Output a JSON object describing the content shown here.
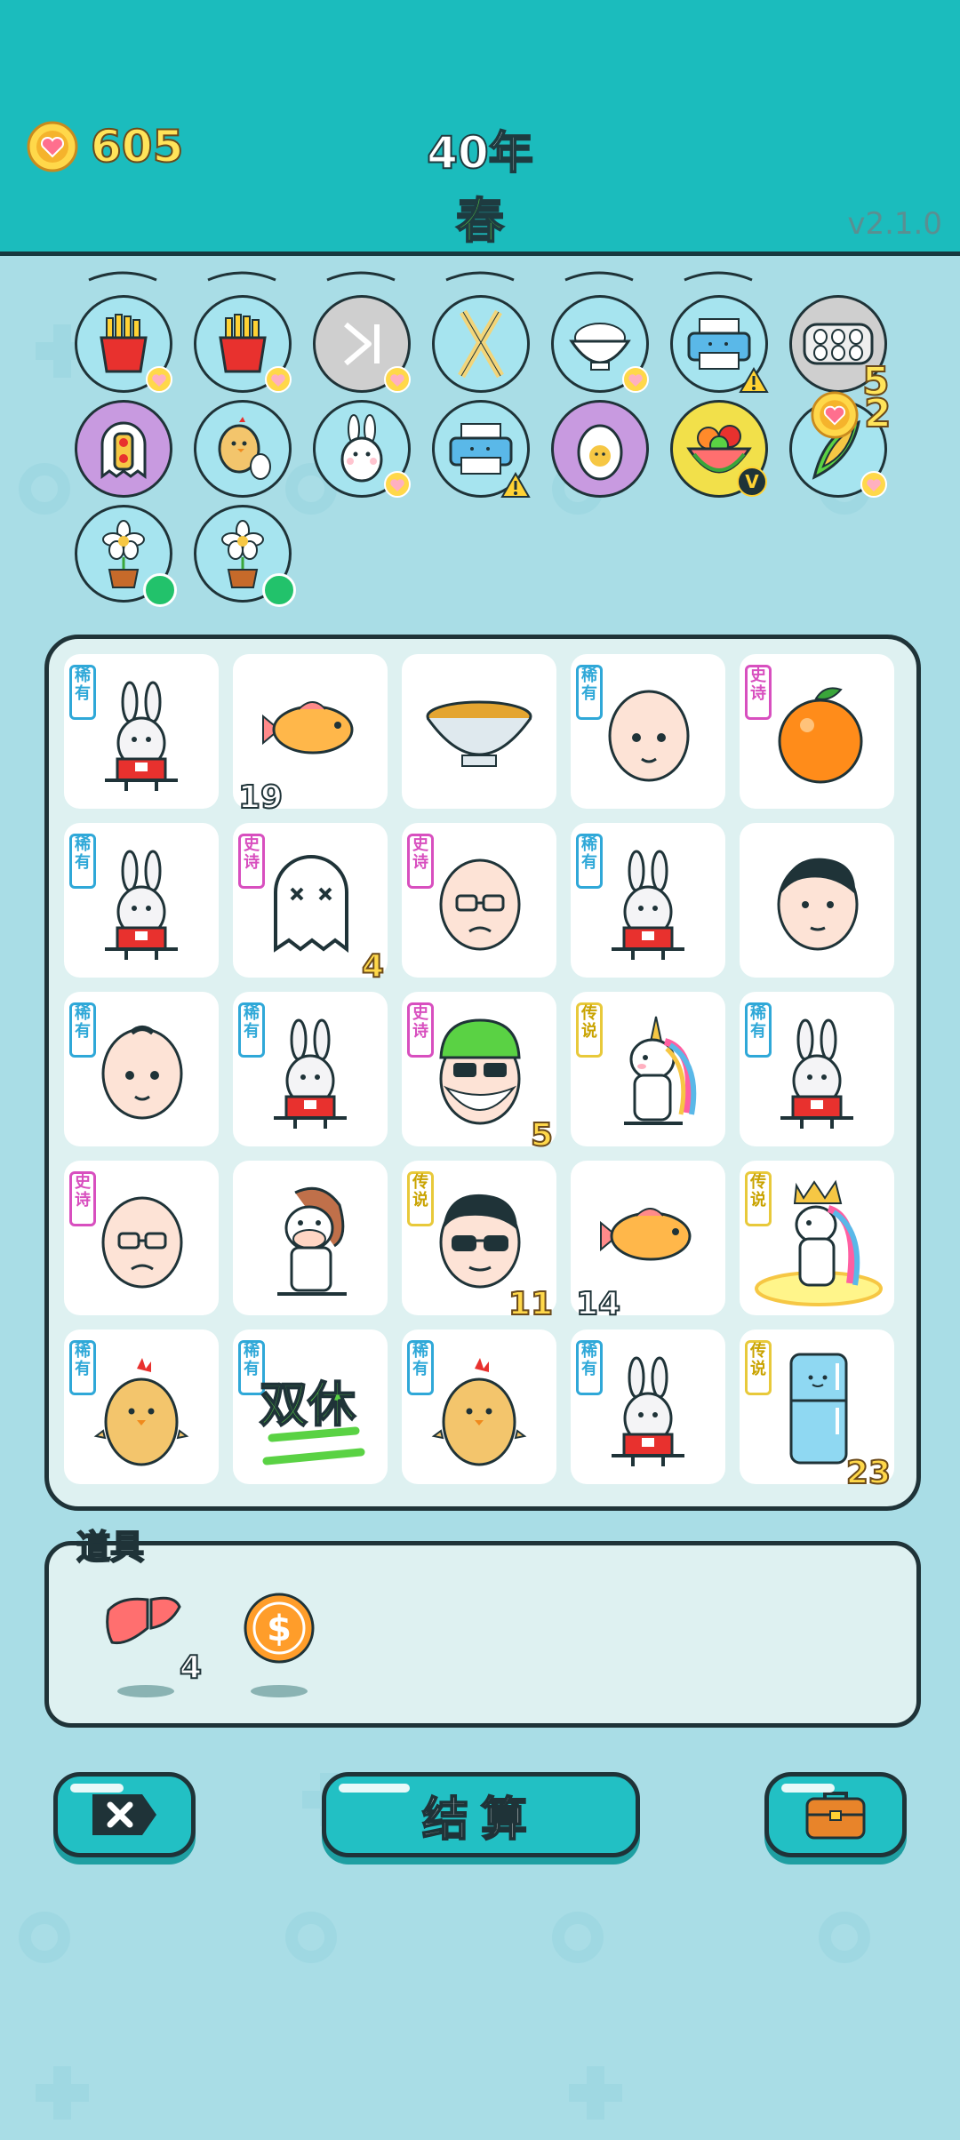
{
  "header": {
    "coins": "605",
    "year": "40年",
    "season": "春",
    "version": "v2.1.0"
  },
  "inventory": {
    "row1": [
      "fries",
      "fries",
      "skip",
      "chopsticks",
      "rice-bowl",
      "printer",
      "egg-carton"
    ],
    "row2": [
      "ghost-lantern",
      "chick-egg",
      "rabbit",
      "printer",
      "egg",
      "fruit-bowl",
      "corn"
    ],
    "row3": [
      "flower-pot",
      "flower-pot"
    ],
    "egg_count": "5",
    "corn_count": "2"
  },
  "board": {
    "tags": {
      "rare": "稀有",
      "epic": "史诗",
      "legend": "传说"
    },
    "cells": [
      {
        "item": "rabbit",
        "tag": "rare",
        "num": ""
      },
      {
        "item": "fish",
        "tag": "",
        "num": "19",
        "numStyle": "white"
      },
      {
        "item": "soup-bowl",
        "tag": "",
        "num": ""
      },
      {
        "item": "bald-man",
        "tag": "rare",
        "num": ""
      },
      {
        "item": "orange",
        "tag": "epic",
        "num": ""
      },
      {
        "item": "rabbit",
        "tag": "rare",
        "num": ""
      },
      {
        "item": "ghost",
        "tag": "epic",
        "num": "4",
        "numStyle": "yellow"
      },
      {
        "item": "old-man-glasses",
        "tag": "epic",
        "num": ""
      },
      {
        "item": "rabbit",
        "tag": "rare",
        "num": ""
      },
      {
        "item": "man-face",
        "tag": "",
        "num": ""
      },
      {
        "item": "bald-man",
        "tag": "rare",
        "num": ""
      },
      {
        "item": "rabbit",
        "tag": "rare",
        "num": ""
      },
      {
        "item": "green-hat-man",
        "tag": "epic",
        "num": "5",
        "numStyle": "yellow"
      },
      {
        "item": "unicorn",
        "tag": "legend",
        "num": ""
      },
      {
        "item": "rabbit",
        "tag": "rare",
        "num": ""
      },
      {
        "item": "old-man-glasses",
        "tag": "epic",
        "num": ""
      },
      {
        "item": "horse",
        "tag": "",
        "num": ""
      },
      {
        "item": "sunglasses-man",
        "tag": "legend",
        "num": "11",
        "numStyle": "yellow"
      },
      {
        "item": "fish",
        "tag": "",
        "num": "14",
        "numStyle": "white"
      },
      {
        "item": "unicorn-king",
        "tag": "legend",
        "num": ""
      },
      {
        "item": "chick",
        "tag": "rare",
        "num": ""
      },
      {
        "item": "weekend-sign",
        "tag": "rare",
        "num": "",
        "text": "双休"
      },
      {
        "item": "chick",
        "tag": "rare",
        "num": ""
      },
      {
        "item": "rabbit",
        "tag": "rare",
        "num": ""
      },
      {
        "item": "fridge",
        "tag": "legend",
        "num": "23",
        "numStyle": "yellow"
      }
    ]
  },
  "props": {
    "label": "道具",
    "items": [
      {
        "icon": "liver-icon",
        "count": "4"
      },
      {
        "icon": "dollar-coin-icon",
        "count": ""
      }
    ]
  },
  "buttons": {
    "close_icon": "close-icon",
    "settle_label": "结算",
    "bag_icon": "briefcase-icon"
  },
  "colors": {
    "header_bg": "#1bbcbd",
    "page_bg": "#a9dde6",
    "coin_text": "#ffe45a",
    "season_text": "#5ad244"
  }
}
